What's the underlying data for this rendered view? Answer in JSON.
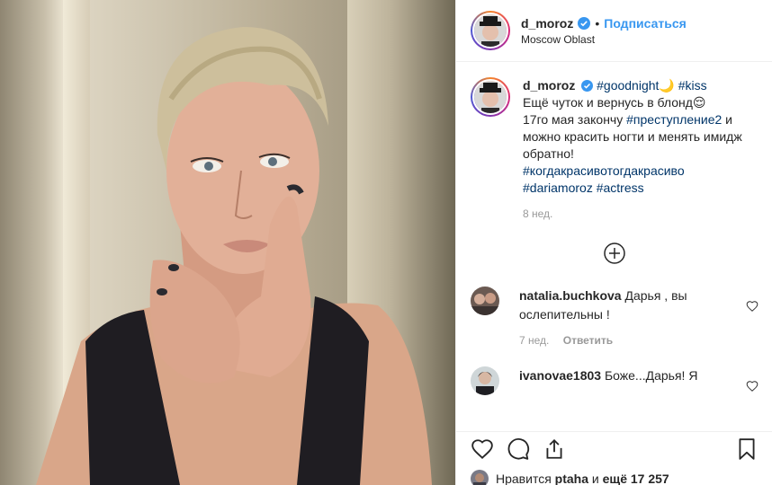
{
  "post": {
    "username": "d_moroz",
    "follow_label": "Подписаться",
    "location": "Moscow Oblast"
  },
  "caption": {
    "username": "d_moroz",
    "tag1": "#goodnight",
    "moon": "🌙",
    "tag2": "#kiss",
    "line1": "Ещё чуток и вернусь в блонд😌",
    "line2a": "17го мая закончу ",
    "tag3": "#преступление2",
    "line2b": " и можно красить ногти и менять имидж обратно!",
    "tag4": "#когдакрасивотогдакрасиво",
    "tag5": "#dariamoroz",
    "tag6": "#actress",
    "time": "8 нед."
  },
  "comments": [
    {
      "username": "natalia.buchkova",
      "text": "Дарья , вы ослепительны !",
      "time": "7 нед.",
      "reply": "Ответить"
    },
    {
      "username": "ivanovae1803",
      "text": "Боже...Дарья! Я"
    }
  ],
  "likes": {
    "prefix": "Нравится",
    "user": "ptaha",
    "middle": "и",
    "count": "ещё 17 257"
  },
  "icons": {
    "verified": "verified-badge-icon",
    "more": "plus-circle-icon",
    "like": "heart-icon",
    "comment": "comment-bubble-icon",
    "share": "share-icon",
    "save": "bookmark-icon"
  },
  "colors": {
    "link": "#3897f0",
    "hashtag": "#003569",
    "muted": "#999999"
  }
}
